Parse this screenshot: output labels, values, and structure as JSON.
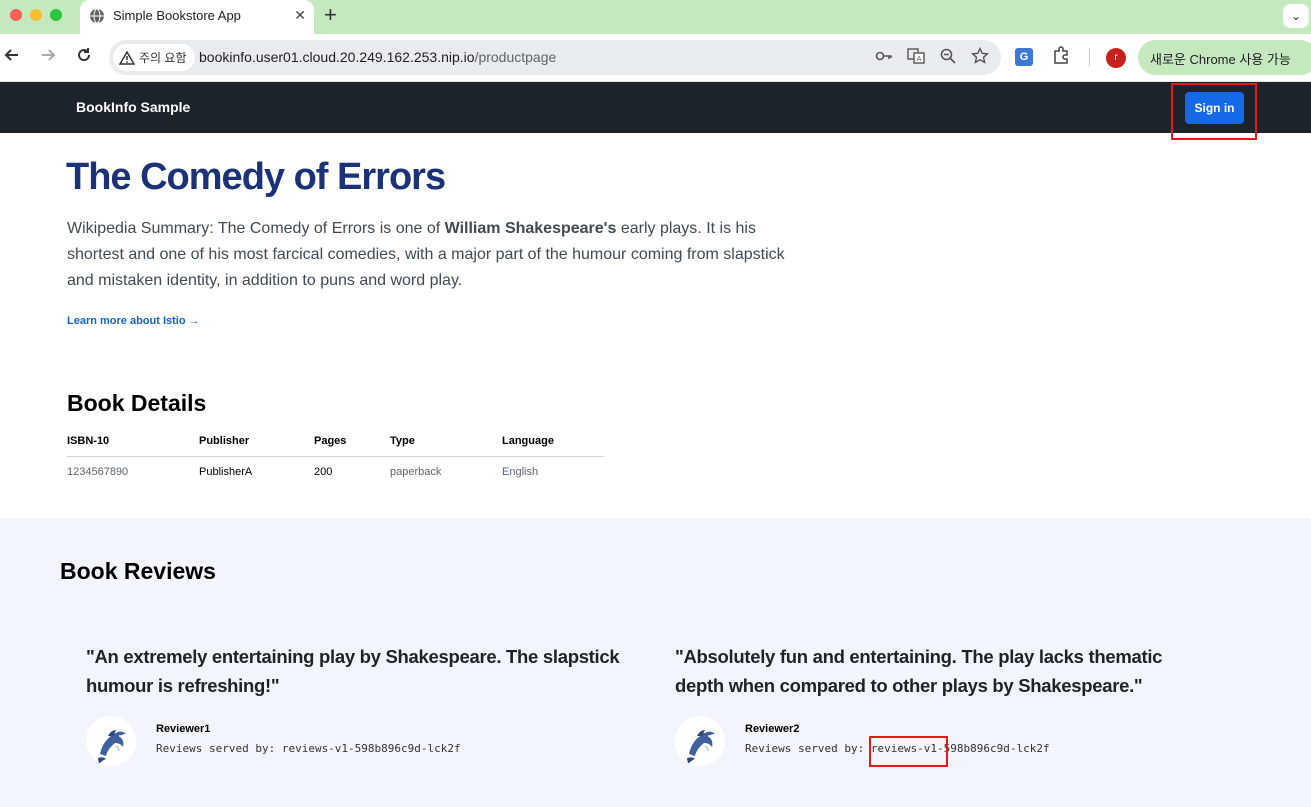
{
  "browser": {
    "tab_title": "Simple Bookstore App",
    "tab_close": "✕",
    "new_tab": "+",
    "tab_menu": "⌄",
    "security_label": "주의 요함",
    "url_host": "bookinfo.user01.cloud.20.249.162.253.nip.io",
    "url_path": "/productpage",
    "profile_initial": "r",
    "update_label": "새로운 Chrome 사용 가능",
    "icons": [
      "back-icon",
      "forward-icon",
      "reload-icon",
      "key-icon",
      "translate-icon",
      "zoom-icon",
      "star-icon",
      "extension-icon"
    ]
  },
  "navbar": {
    "brand": "BookInfo Sample",
    "signin": "Sign in"
  },
  "product": {
    "title": "The Comedy of Errors",
    "summary_before": "Wikipedia Summary: The Comedy of Errors is one of ",
    "summary_bold": "William Shakespeare's",
    "summary_after": " early plays. It is his shortest and one of his most farcical comedies, with a major part of the humour coming from slapstick and mistaken identity, in addition to puns and word play.",
    "learn_more": "Learn more about Istio →"
  },
  "details": {
    "heading": "Book Details",
    "columns": [
      "ISBN-10",
      "Publisher",
      "Pages",
      "Type",
      "Language"
    ],
    "row": [
      "1234567890",
      "PublisherA",
      "200",
      "paperback",
      "English"
    ]
  },
  "reviews": {
    "heading": "Book Reviews",
    "items": [
      {
        "text": "\"An extremely entertaining play by Shakespeare. The slapstick humour is refreshing!\"",
        "reviewer": "Reviewer1",
        "served": "Reviews served by: reviews-v1-598b896c9d-lck2f"
      },
      {
        "text": "\"Absolutely fun and entertaining. The play lacks thematic depth when compared to other plays by Shakespeare.\"",
        "reviewer": "Reviewer2",
        "served": "Reviews served by: reviews-v1-598b896c9d-lck2f"
      }
    ]
  },
  "colors": {
    "tabstrip": "#c5e8bf",
    "navbar": "#1d232a",
    "signin": "#1669e6",
    "title": "#1b3278",
    "highlight": "#e81818",
    "reviews_bg": "#f2f6fc"
  }
}
